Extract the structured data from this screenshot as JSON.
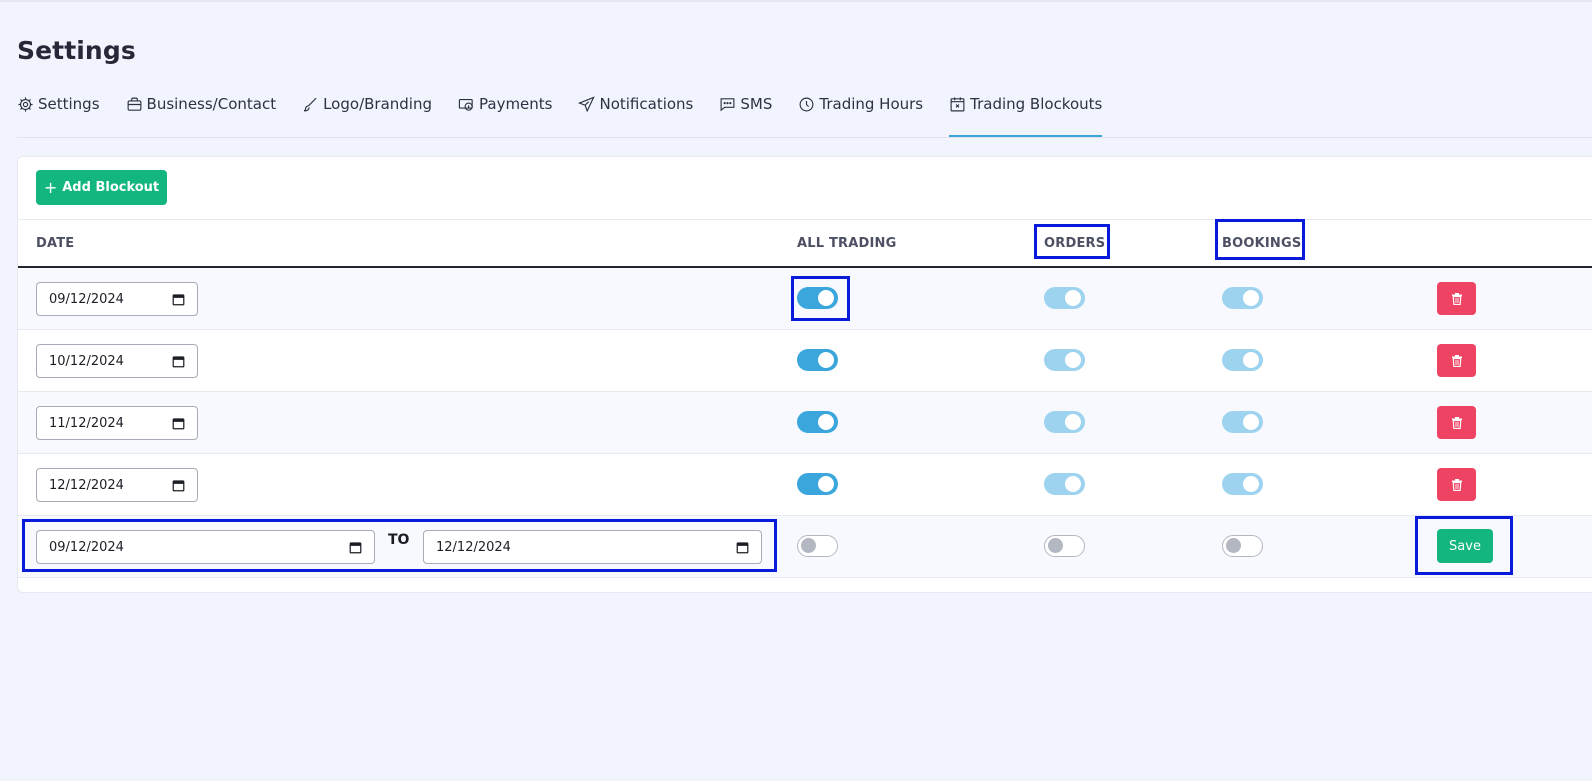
{
  "page": {
    "title": "Settings"
  },
  "tabs": [
    {
      "label": "Settings",
      "icon": "gear-icon"
    },
    {
      "label": "Business/Contact",
      "icon": "briefcase-icon"
    },
    {
      "label": "Logo/Branding",
      "icon": "brush-icon"
    },
    {
      "label": "Payments",
      "icon": "cash-icon"
    },
    {
      "label": "Notifications",
      "icon": "send-icon"
    },
    {
      "label": "SMS",
      "icon": "message-icon"
    },
    {
      "label": "Trading Hours",
      "icon": "clock-icon"
    },
    {
      "label": "Trading Blockouts",
      "icon": "calendar-x-icon",
      "active": true
    }
  ],
  "toolbar": {
    "add_label": "Add Blockout"
  },
  "table": {
    "columns": {
      "date": "DATE",
      "all_trading": "ALL TRADING",
      "orders": "ORDERS",
      "bookings": "BOOKINGS"
    },
    "rows": [
      {
        "date": "09/12/2024",
        "all_trading": true,
        "orders": true,
        "bookings": true
      },
      {
        "date": "10/12/2024",
        "all_trading": true,
        "orders": true,
        "bookings": true
      },
      {
        "date": "11/12/2024",
        "all_trading": true,
        "orders": true,
        "bookings": true
      },
      {
        "date": "12/12/2024",
        "all_trading": true,
        "orders": true,
        "bookings": true
      }
    ],
    "new_row": {
      "from_date": "09/12/2024",
      "to_label": "TO",
      "to_date": "12/12/2024",
      "all_trading": false,
      "orders": false,
      "bookings": false,
      "save_label": "Save"
    }
  },
  "colors": {
    "accent": "#3aa6dc",
    "primary_button": "#12b67e",
    "danger_button": "#ee4363",
    "highlight_box": "#0a1adb"
  }
}
